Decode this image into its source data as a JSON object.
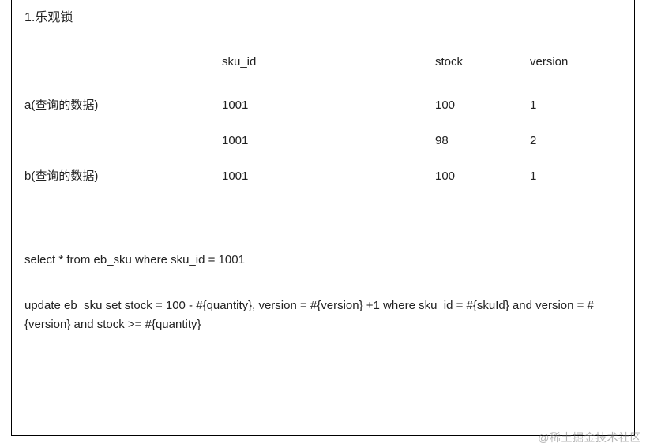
{
  "title": "1.乐观锁",
  "table": {
    "headers": {
      "label": "",
      "sku_id": "sku_id",
      "stock": "stock",
      "version": "version"
    },
    "rows": [
      {
        "label": "a(查询的数据)",
        "sku_id": "1001",
        "stock": "100",
        "version": "1"
      },
      {
        "label": "",
        "sku_id": "1001",
        "stock": "98",
        "version": "2"
      },
      {
        "label": "b(查询的数据)",
        "sku_id": "1001",
        "stock": "100",
        "version": "1"
      }
    ]
  },
  "sql": {
    "select": "select * from eb_sku where sku_id  = 1001",
    "update": "update eb_sku set stock = 100 - #{quantity},  version = #{version} +1 where sku_id = #{skuId} and version = #{version} and stock >= #{quantity}"
  },
  "watermark": "@稀土掘金技术社区"
}
